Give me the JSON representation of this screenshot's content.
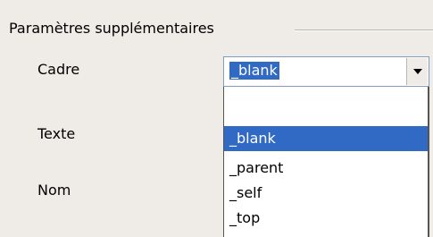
{
  "section": {
    "title": "Paramètres supplémentaires"
  },
  "fields": {
    "cadre_label": "Cadre",
    "texte_label": "Texte",
    "nom_label": "Nom"
  },
  "combo": {
    "value": "_blank",
    "button_icon": "chevron-down-icon"
  },
  "dropdown": {
    "options": [
      "",
      "_blank",
      "_parent",
      "_self",
      "_top"
    ],
    "selected": "_blank"
  },
  "colors": {
    "selection": "#316ac5",
    "background": "#efebe7"
  }
}
